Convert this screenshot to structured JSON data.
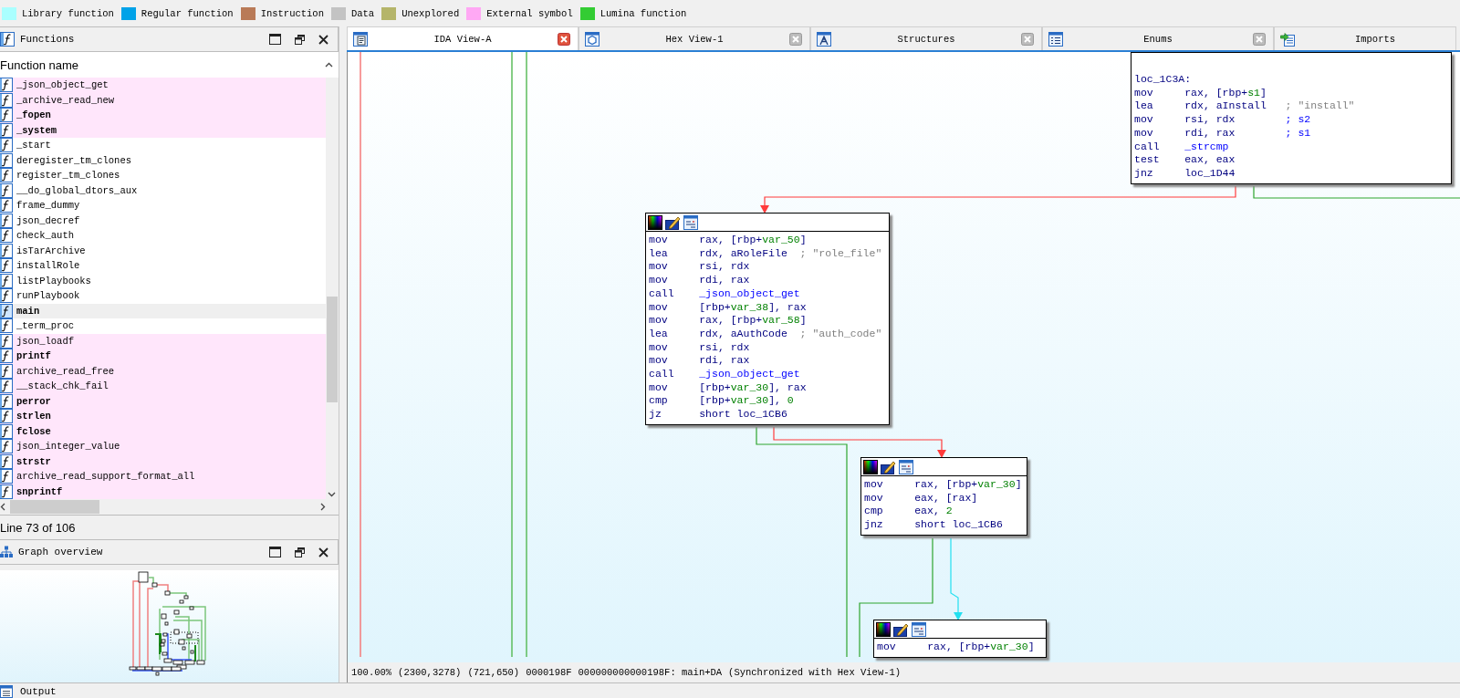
{
  "legend": [
    {
      "label": "Library function",
      "color": "#aaffff"
    },
    {
      "label": "Regular function",
      "color": "#00a2e8"
    },
    {
      "label": "Instruction",
      "color": "#b97a57"
    },
    {
      "label": "Data",
      "color": "#c3c3c3"
    },
    {
      "label": "Unexplored",
      "color": "#b5b56a"
    },
    {
      "label": "External symbol",
      "color": "#ffa8f4"
    },
    {
      "label": "Lumina function",
      "color": "#33cc33"
    }
  ],
  "functions_panel": {
    "title": "Functions",
    "column": "Function name",
    "rows": [
      {
        "name": "_json_object_get",
        "kind": "external",
        "bold": false,
        "selected": false
      },
      {
        "name": "_archive_read_new",
        "kind": "external",
        "bold": false,
        "selected": false
      },
      {
        "name": "_fopen",
        "kind": "external",
        "bold": true,
        "selected": false
      },
      {
        "name": "_system",
        "kind": "external",
        "bold": true,
        "selected": false
      },
      {
        "name": "_start",
        "kind": "regular",
        "bold": false,
        "selected": false
      },
      {
        "name": "deregister_tm_clones",
        "kind": "regular",
        "bold": false,
        "selected": false
      },
      {
        "name": "register_tm_clones",
        "kind": "regular",
        "bold": false,
        "selected": false
      },
      {
        "name": "__do_global_dtors_aux",
        "kind": "regular",
        "bold": false,
        "selected": false
      },
      {
        "name": "frame_dummy",
        "kind": "regular",
        "bold": false,
        "selected": false
      },
      {
        "name": "json_decref",
        "kind": "regular",
        "bold": false,
        "selected": false
      },
      {
        "name": "check_auth",
        "kind": "regular",
        "bold": false,
        "selected": false
      },
      {
        "name": "isTarArchive",
        "kind": "regular",
        "bold": false,
        "selected": false
      },
      {
        "name": "installRole",
        "kind": "regular",
        "bold": false,
        "selected": false
      },
      {
        "name": "listPlaybooks",
        "kind": "regular",
        "bold": false,
        "selected": false
      },
      {
        "name": "runPlaybook",
        "kind": "regular",
        "bold": false,
        "selected": false
      },
      {
        "name": "main",
        "kind": "regular",
        "bold": true,
        "selected": true
      },
      {
        "name": "_term_proc",
        "kind": "regular",
        "bold": false,
        "selected": false
      },
      {
        "name": "json_loadf",
        "kind": "external",
        "bold": false,
        "selected": false
      },
      {
        "name": "printf",
        "kind": "external",
        "bold": true,
        "selected": false
      },
      {
        "name": "archive_read_free",
        "kind": "external",
        "bold": false,
        "selected": false
      },
      {
        "name": "__stack_chk_fail",
        "kind": "external",
        "bold": false,
        "selected": false
      },
      {
        "name": "perror",
        "kind": "external",
        "bold": true,
        "selected": false
      },
      {
        "name": "strlen",
        "kind": "external",
        "bold": true,
        "selected": false
      },
      {
        "name": "fclose",
        "kind": "external",
        "bold": true,
        "selected": false
      },
      {
        "name": "json_integer_value",
        "kind": "external",
        "bold": false,
        "selected": false
      },
      {
        "name": "strstr",
        "kind": "external",
        "bold": true,
        "selected": false
      },
      {
        "name": "archive_read_support_format_all",
        "kind": "external",
        "bold": false,
        "selected": false
      },
      {
        "name": "snprintf",
        "kind": "external",
        "bold": true,
        "selected": false
      }
    ],
    "line_info": "Line 73 of 106"
  },
  "graph_overview": {
    "title": "Graph overview"
  },
  "tabs": [
    {
      "label": "IDA View-A",
      "kind": "listing",
      "selected": true
    },
    {
      "label": "Hex View-1",
      "kind": "hex",
      "selected": false
    },
    {
      "label": "Structures",
      "kind": "structures",
      "selected": false
    },
    {
      "label": "Enums",
      "kind": "enums",
      "selected": false
    },
    {
      "label": "Imports",
      "kind": "imports",
      "selected": false
    }
  ],
  "graph": {
    "nodes": [
      {
        "toolbar": false,
        "lines": [
          {
            "kind": "label",
            "text": "loc_1C3A:"
          },
          {
            "kind": "insn",
            "op": "mov",
            "args": [
              {
                "t": "rax, [rbp+",
                "kind": "register"
              },
              {
                "t": "s1",
                "kind": "variable"
              },
              {
                "t": "]",
                "kind": "register"
              }
            ]
          },
          {
            "kind": "insn",
            "op": "lea",
            "args": [
              {
                "t": "rdx, aInstall",
                "kind": "register"
              }
            ],
            "comment": {
              "t": "; \"install\"",
              "kind": "string"
            }
          },
          {
            "kind": "insn",
            "op": "mov",
            "args": [
              {
                "t": "rsi, rdx",
                "kind": "register"
              }
            ],
            "comment": {
              "t": "; s2",
              "kind": "symbol"
            }
          },
          {
            "kind": "insn",
            "op": "mov",
            "args": [
              {
                "t": "rdi, rax",
                "kind": "register"
              }
            ],
            "comment": {
              "t": "; s1",
              "kind": "symbol"
            }
          },
          {
            "kind": "insn",
            "op": "call",
            "args": [
              {
                "t": "_strcmp",
                "kind": "function"
              }
            ]
          },
          {
            "kind": "insn",
            "op": "test",
            "args": [
              {
                "t": "eax, eax",
                "kind": "register"
              }
            ]
          },
          {
            "kind": "insn",
            "op": "jnz",
            "args": [
              {
                "t": "loc_1D44",
                "kind": "register"
              }
            ]
          }
        ]
      },
      {
        "toolbar": true,
        "lines": [
          {
            "kind": "insn",
            "op": "mov",
            "args": [
              {
                "t": "rax, [rbp+",
                "kind": "register"
              },
              {
                "t": "var_50",
                "kind": "variable"
              },
              {
                "t": "]",
                "kind": "register"
              }
            ]
          },
          {
            "kind": "insn",
            "op": "lea",
            "args": [
              {
                "t": "rdx, aRoleFile",
                "kind": "register"
              }
            ],
            "comment": {
              "t": "; \"role_file\"",
              "kind": "string"
            }
          },
          {
            "kind": "insn",
            "op": "mov",
            "args": [
              {
                "t": "rsi, rdx",
                "kind": "register"
              }
            ]
          },
          {
            "kind": "insn",
            "op": "mov",
            "args": [
              {
                "t": "rdi, rax",
                "kind": "register"
              }
            ]
          },
          {
            "kind": "insn",
            "op": "call",
            "args": [
              {
                "t": "_json_object_get",
                "kind": "function"
              }
            ]
          },
          {
            "kind": "insn",
            "op": "mov",
            "args": [
              {
                "t": "[rbp+",
                "kind": "register"
              },
              {
                "t": "var_38",
                "kind": "variable"
              },
              {
                "t": "], rax",
                "kind": "register"
              }
            ]
          },
          {
            "kind": "insn",
            "op": "mov",
            "args": [
              {
                "t": "rax, [rbp+",
                "kind": "register"
              },
              {
                "t": "var_58",
                "kind": "variable"
              },
              {
                "t": "]",
                "kind": "register"
              }
            ]
          },
          {
            "kind": "insn",
            "op": "lea",
            "args": [
              {
                "t": "rdx, aAuthCode",
                "kind": "register"
              }
            ],
            "comment": {
              "t": "; \"auth_code\"",
              "kind": "string"
            }
          },
          {
            "kind": "insn",
            "op": "mov",
            "args": [
              {
                "t": "rsi, rdx",
                "kind": "register"
              }
            ]
          },
          {
            "kind": "insn",
            "op": "mov",
            "args": [
              {
                "t": "rdi, rax",
                "kind": "register"
              }
            ]
          },
          {
            "kind": "insn",
            "op": "call",
            "args": [
              {
                "t": "_json_object_get",
                "kind": "function"
              }
            ]
          },
          {
            "kind": "insn",
            "op": "mov",
            "args": [
              {
                "t": "[rbp+",
                "kind": "register"
              },
              {
                "t": "var_30",
                "kind": "variable"
              },
              {
                "t": "], rax",
                "kind": "register"
              }
            ]
          },
          {
            "kind": "insn",
            "op": "cmp",
            "args": [
              {
                "t": "[rbp+",
                "kind": "register"
              },
              {
                "t": "var_30",
                "kind": "variable"
              },
              {
                "t": "], ",
                "kind": "register"
              },
              {
                "t": "0",
                "kind": "number"
              }
            ]
          },
          {
            "kind": "insn",
            "op": "jz",
            "args": [
              {
                "t": "short loc_1CB6",
                "kind": "register"
              }
            ]
          }
        ]
      },
      {
        "toolbar": true,
        "lines": [
          {
            "kind": "insn",
            "op": "mov",
            "args": [
              {
                "t": "rax, [rbp+",
                "kind": "register"
              },
              {
                "t": "var_30",
                "kind": "variable"
              },
              {
                "t": "]",
                "kind": "register"
              }
            ]
          },
          {
            "kind": "insn",
            "op": "mov",
            "args": [
              {
                "t": "eax, [rax]",
                "kind": "register"
              }
            ]
          },
          {
            "kind": "insn",
            "op": "cmp",
            "args": [
              {
                "t": "eax, ",
                "kind": "register"
              },
              {
                "t": "2",
                "kind": "number"
              }
            ]
          },
          {
            "kind": "insn",
            "op": "jnz",
            "args": [
              {
                "t": "short loc_1CB6",
                "kind": "register"
              }
            ]
          }
        ]
      },
      {
        "toolbar": true,
        "lines": [
          {
            "kind": "insn",
            "op": "mov",
            "args": [
              {
                "t": "rax, [rbp+",
                "kind": "register"
              },
              {
                "t": "var_30",
                "kind": "variable"
              },
              {
                "t": "]",
                "kind": "register"
              }
            ]
          }
        ]
      }
    ]
  },
  "status_bar": [
    "100.00%",
    "(2300,3278)",
    "(721,650)",
    "0000198F",
    "000000000000198F: main+DA",
    "(Synchronized with Hex View-1)"
  ],
  "output": {
    "title": "Output"
  }
}
